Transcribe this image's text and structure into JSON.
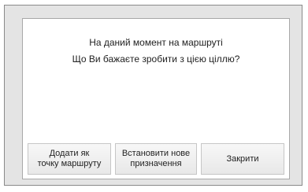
{
  "dialog": {
    "message_line1": "На даний момент на маршруті",
    "message_line2": "Що Ви бажаєте зробити з цією ціллю?",
    "buttons": {
      "add_waypoint_line1": "Додати як",
      "add_waypoint_line2": "точку маршруту",
      "set_destination_line1": "Встановити нове",
      "set_destination_line2": "призначення",
      "close": "Закрити"
    }
  }
}
